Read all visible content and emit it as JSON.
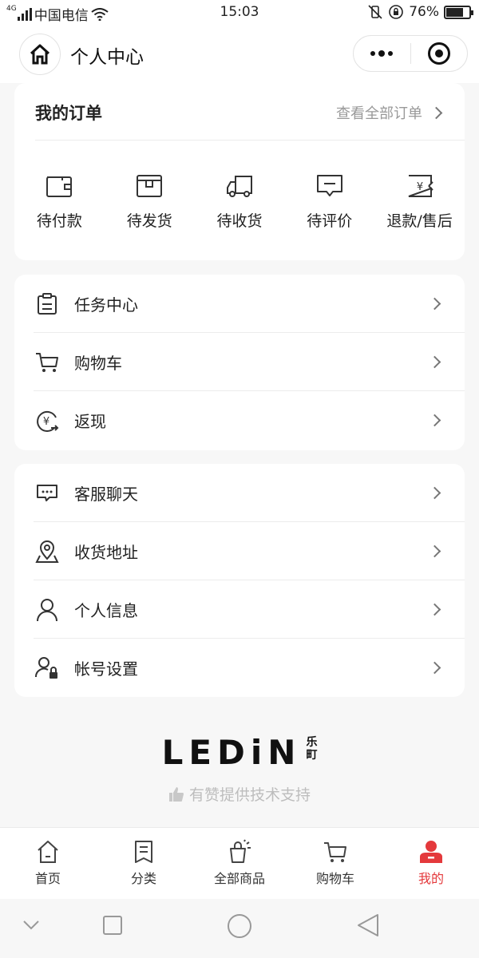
{
  "status_bar": {
    "signal": "4G",
    "carrier": "中国电信",
    "time": "15:03",
    "battery": "76%",
    "battery_level": 0.76
  },
  "nav": {
    "title": "个人中心",
    "home_icon": "home-icon",
    "more_icon": "more-dots-icon",
    "close_icon": "target-icon"
  },
  "orders": {
    "title": "我的订单",
    "view_all": "查看全部订单",
    "items": [
      {
        "label": "待付款",
        "icon": "wallet-icon"
      },
      {
        "label": "待发货",
        "icon": "package-icon"
      },
      {
        "label": "待收货",
        "icon": "truck-icon"
      },
      {
        "label": "待评价",
        "icon": "comment-icon"
      },
      {
        "label": "退款/售后",
        "icon": "refund-icon"
      }
    ]
  },
  "menu1": [
    {
      "label": "任务中心",
      "icon": "clipboard-icon"
    },
    {
      "label": "购物车",
      "icon": "cart-icon"
    },
    {
      "label": "返现",
      "icon": "cashback-icon"
    }
  ],
  "menu2": [
    {
      "label": "客服聊天",
      "icon": "chat-icon"
    },
    {
      "label": "收货地址",
      "icon": "location-icon"
    },
    {
      "label": "个人信息",
      "icon": "user-icon"
    },
    {
      "label": "帐号设置",
      "icon": "user-lock-icon"
    }
  ],
  "brand": {
    "logo": "LEDiN",
    "logo_cn_top": "乐",
    "logo_cn_bottom": "町",
    "powered": "有赞提供技术支持"
  },
  "tabs": [
    {
      "label": "首页",
      "icon": "home-icon",
      "active": false
    },
    {
      "label": "分类",
      "icon": "category-icon",
      "active": false
    },
    {
      "label": "全部商品",
      "icon": "shopping-bag-icon",
      "active": false
    },
    {
      "label": "购物车",
      "icon": "cart-icon",
      "active": false
    },
    {
      "label": "我的",
      "icon": "profile-icon",
      "active": true
    }
  ],
  "colors": {
    "accent": "#e4393c",
    "background": "#f7f7f7",
    "card": "#ffffff",
    "muted_text": "#999999"
  }
}
